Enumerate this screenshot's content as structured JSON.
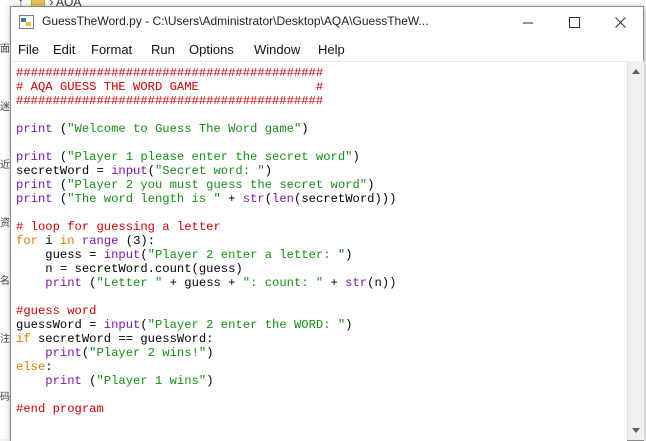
{
  "background": {
    "breadcrumb_text": "AQA",
    "left_strip_chars": [
      "面",
      "迷",
      "近",
      "资",
      "名",
      "注",
      "码"
    ]
  },
  "window": {
    "title": "GuessTheWord.py - C:\\Users\\Administrator\\Desktop\\AQA\\GuessTheW..."
  },
  "menu": [
    "File",
    "Edit",
    "Format",
    "Run",
    "Options",
    "Window",
    "Help"
  ],
  "code_lines": [
    [
      {
        "t": "##########################################",
        "c": "red"
      }
    ],
    [
      {
        "t": "# AQA GUESS THE WORD GAME                #",
        "c": "red"
      }
    ],
    [
      {
        "t": "##########################################",
        "c": "red"
      }
    ],
    [
      {
        "t": "",
        "c": "black"
      }
    ],
    [
      {
        "t": "print",
        "c": "purple"
      },
      {
        "t": " (",
        "c": "black"
      },
      {
        "t": "\"Welcome to Guess The Word game\"",
        "c": "green"
      },
      {
        "t": ")",
        "c": "black"
      }
    ],
    [
      {
        "t": "",
        "c": "black"
      }
    ],
    [
      {
        "t": "print",
        "c": "purple"
      },
      {
        "t": " (",
        "c": "black"
      },
      {
        "t": "\"Player 1 please enter the secret word\"",
        "c": "green"
      },
      {
        "t": ")",
        "c": "black"
      }
    ],
    [
      {
        "t": "secretWord = ",
        "c": "black"
      },
      {
        "t": "input",
        "c": "purple"
      },
      {
        "t": "(",
        "c": "black"
      },
      {
        "t": "\"Secret word: \"",
        "c": "green"
      },
      {
        "t": ")",
        "c": "black"
      }
    ],
    [
      {
        "t": "print",
        "c": "purple"
      },
      {
        "t": " (",
        "c": "black"
      },
      {
        "t": "\"Player 2 you must guess the secret word\"",
        "c": "green"
      },
      {
        "t": ")",
        "c": "black"
      }
    ],
    [
      {
        "t": "print",
        "c": "purple"
      },
      {
        "t": " (",
        "c": "black"
      },
      {
        "t": "\"The word length is \"",
        "c": "green"
      },
      {
        "t": " + ",
        "c": "black"
      },
      {
        "t": "str",
        "c": "purple"
      },
      {
        "t": "(",
        "c": "black"
      },
      {
        "t": "len",
        "c": "purple"
      },
      {
        "t": "(secretWord)))",
        "c": "black"
      }
    ],
    [
      {
        "t": "",
        "c": "black"
      }
    ],
    [
      {
        "t": "# loop for guessing a letter",
        "c": "red"
      }
    ],
    [
      {
        "t": "for",
        "c": "orange"
      },
      {
        "t": " i ",
        "c": "black"
      },
      {
        "t": "in",
        "c": "orange"
      },
      {
        "t": " ",
        "c": "black"
      },
      {
        "t": "range",
        "c": "purple"
      },
      {
        "t": " (3):",
        "c": "black"
      }
    ],
    [
      {
        "t": "    guess = ",
        "c": "black"
      },
      {
        "t": "input",
        "c": "purple"
      },
      {
        "t": "(",
        "c": "black"
      },
      {
        "t": "\"Player 2 enter a letter: \"",
        "c": "green"
      },
      {
        "t": ")",
        "c": "black"
      }
    ],
    [
      {
        "t": "    n = secretWord.count(guess)",
        "c": "black"
      }
    ],
    [
      {
        "t": "    ",
        "c": "black"
      },
      {
        "t": "print",
        "c": "purple"
      },
      {
        "t": " (",
        "c": "black"
      },
      {
        "t": "\"Letter \"",
        "c": "green"
      },
      {
        "t": " + guess + ",
        "c": "black"
      },
      {
        "t": "\": count: \"",
        "c": "green"
      },
      {
        "t": " + ",
        "c": "black"
      },
      {
        "t": "str",
        "c": "purple"
      },
      {
        "t": "(n))",
        "c": "black"
      }
    ],
    [
      {
        "t": "",
        "c": "black"
      }
    ],
    [
      {
        "t": "#guess word",
        "c": "red"
      }
    ],
    [
      {
        "t": "guessWord = ",
        "c": "black"
      },
      {
        "t": "input",
        "c": "purple"
      },
      {
        "t": "(",
        "c": "black"
      },
      {
        "t": "\"Player 2 enter the WORD: \"",
        "c": "green"
      },
      {
        "t": ")",
        "c": "black"
      }
    ],
    [
      {
        "t": "if",
        "c": "orange"
      },
      {
        "t": " secretWord == guessWord:",
        "c": "black"
      }
    ],
    [
      {
        "t": "    ",
        "c": "black"
      },
      {
        "t": "print",
        "c": "purple"
      },
      {
        "t": "(",
        "c": "black"
      },
      {
        "t": "\"Player 2 wins!\"",
        "c": "green"
      },
      {
        "t": ")",
        "c": "black"
      }
    ],
    [
      {
        "t": "else",
        "c": "orange"
      },
      {
        "t": ":",
        "c": "black"
      }
    ],
    [
      {
        "t": "    ",
        "c": "black"
      },
      {
        "t": "print",
        "c": "purple"
      },
      {
        "t": " (",
        "c": "black"
      },
      {
        "t": "\"Player 1 wins\"",
        "c": "green"
      },
      {
        "t": ")",
        "c": "black"
      }
    ],
    [
      {
        "t": "",
        "c": "black"
      }
    ],
    [
      {
        "t": "#end program",
        "c": "red"
      }
    ]
  ],
  "colors": {
    "comment": "#d40000",
    "builtin": "#7b16b8",
    "keyword": "#e07b00",
    "string": "#149014"
  },
  "icons": [
    "python-file-icon",
    "minimize-icon",
    "maximize-icon",
    "close-icon",
    "scroll-up-icon",
    "scroll-down-icon"
  ]
}
